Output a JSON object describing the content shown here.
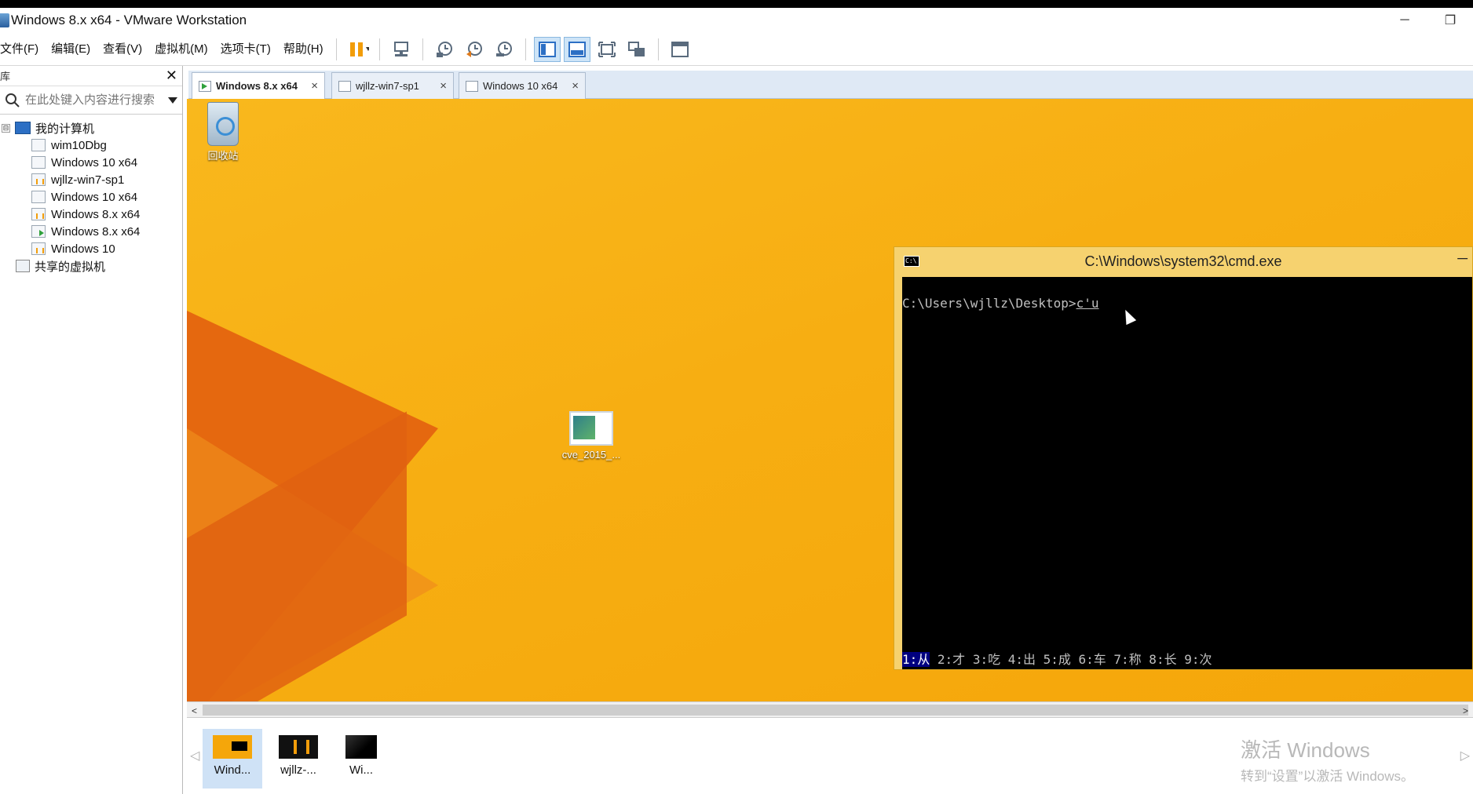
{
  "window": {
    "title": "Windows 8.x x64 - VMware Workstation",
    "minimize": "─",
    "restore": "❐"
  },
  "menu": [
    "文件(F)",
    "编辑(E)",
    "查看(V)",
    "虚拟机(M)",
    "选项卡(T)",
    "帮助(H)"
  ],
  "sidebar": {
    "header": "库",
    "close": "✕",
    "search_placeholder": "在此处键入内容进行搜索",
    "root": "我的计算机",
    "expander": "⊟",
    "items": [
      {
        "label": "wim10Dbg",
        "state": "off"
      },
      {
        "label": "Windows 10 x64",
        "state": "off"
      },
      {
        "label": "wjllz-win7-sp1",
        "state": "paused"
      },
      {
        "label": "Windows 10 x64",
        "state": "off"
      },
      {
        "label": "Windows 8.x x64",
        "state": "paused"
      },
      {
        "label": "Windows 8.x x64",
        "state": "running"
      },
      {
        "label": "Windows 10",
        "state": "paused"
      }
    ],
    "shared": "共享的虚拟机"
  },
  "tabs": [
    {
      "label": "Windows 8.x x64",
      "active": true
    },
    {
      "label": "wjllz-win7-sp1",
      "active": false
    },
    {
      "label": "Windows 10 x64",
      "active": false
    }
  ],
  "tab_close": "×",
  "desktop": {
    "recycle_label": "回收站",
    "file_label": "cve_2015_..."
  },
  "cmd": {
    "title": "C:\\Windows\\system32\\cmd.exe",
    "icon_text": "C:\\",
    "minimize": "─",
    "prompt": "C:\\Users\\wjllz\\Desktop>",
    "typed": "c'u",
    "ime_selected": "1:从",
    "ime_rest": " 2:才 3:吃 4:出 5:成 6:车 7:称 8:长 9:次"
  },
  "scroll": {
    "left": "<",
    "right": ">"
  },
  "thumbnails": [
    {
      "label": "Wind...",
      "kind": "win8",
      "active": true
    },
    {
      "label": "wjllz-...",
      "kind": "paused",
      "active": false
    },
    {
      "label": "Wi...",
      "kind": "dark",
      "active": false
    }
  ],
  "thumbnav": {
    "left": "◁",
    "right": "▷"
  },
  "watermark": {
    "line1": "激活 Windows",
    "line2": "转到“设置”以激活 Windows。"
  },
  "colors": {
    "desktop": "#f7ae12",
    "accent": "#2c6fc4",
    "cmd_title": "#f6d26f"
  }
}
